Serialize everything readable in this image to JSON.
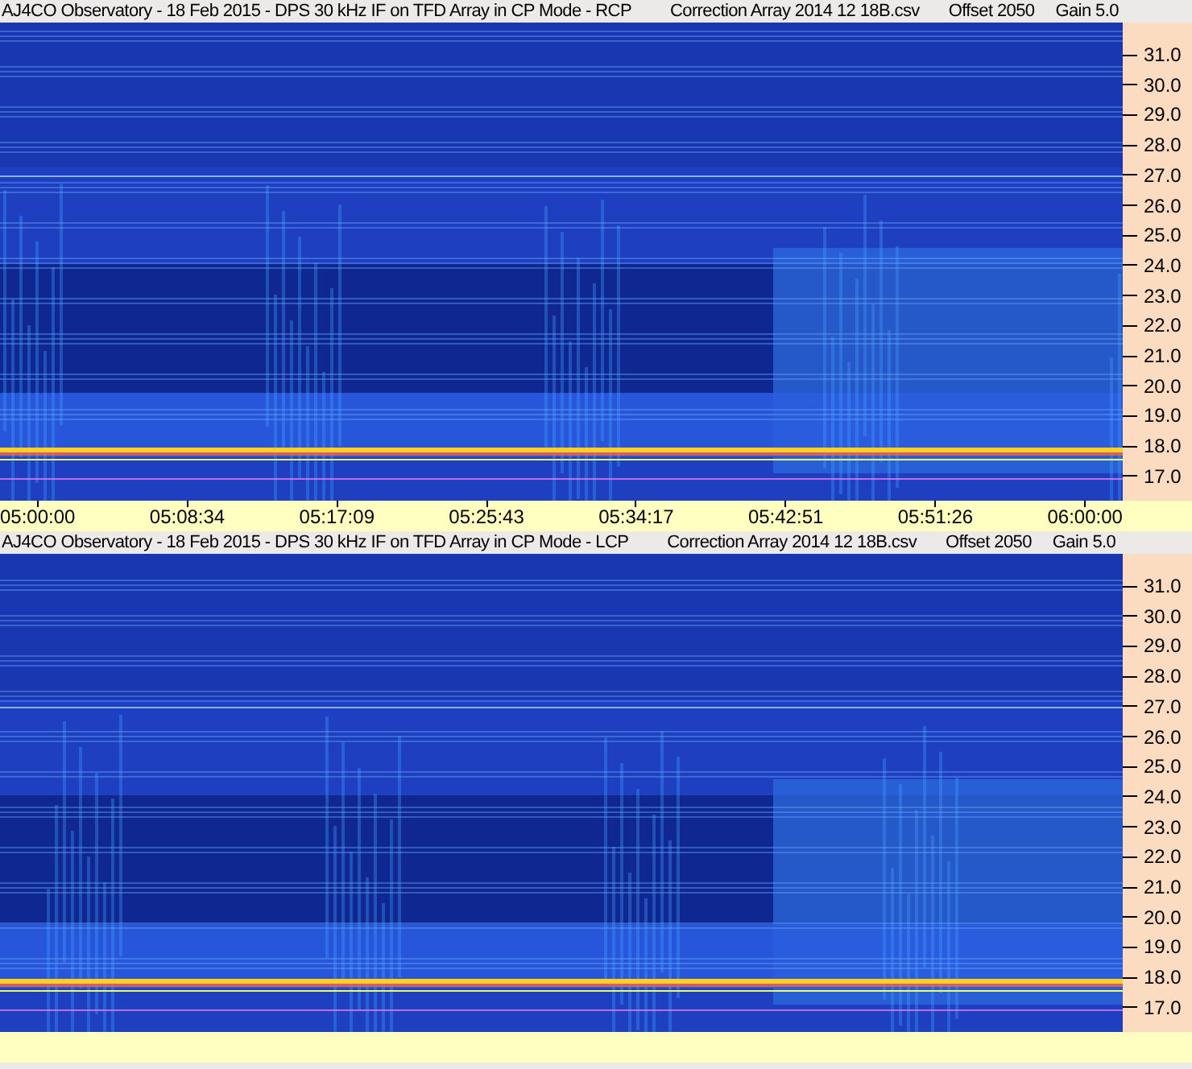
{
  "panels": [
    {
      "title": "AJ4CO Observatory - 18 Feb 2015 - DPS 30 kHz IF on TFD Array in CP Mode - RCP",
      "file": "Correction Array 2014 12 18B.csv",
      "offset": "Offset 2050",
      "gain": "Gain 5.0",
      "yticks": [
        "31.0",
        "30.0",
        "29.0",
        "28.0",
        "27.0",
        "26.0",
        "25.0",
        "24.0",
        "23.0",
        "22.0",
        "21.0",
        "20.0",
        "19.0",
        "18.0",
        "17.0"
      ],
      "xticks": [
        "05:00:00",
        "05:08:34",
        "05:17:09",
        "05:25:43",
        "05:34:17",
        "05:42:51",
        "05:51:26",
        "06:00:00"
      ]
    },
    {
      "title": "AJ4CO Observatory - 18 Feb 2015 - DPS 30 kHz IF on TFD Array in CP Mode - LCP",
      "file": "Correction Array 2014 12 18B.csv",
      "offset": "Offset 2050",
      "gain": "Gain 5.0",
      "yticks": [
        "31.0",
        "30.0",
        "29.0",
        "28.0",
        "27.0",
        "26.0",
        "25.0",
        "24.0",
        "23.0",
        "22.0",
        "21.0",
        "20.0",
        "19.0",
        "18.0",
        "17.0"
      ]
    }
  ]
}
